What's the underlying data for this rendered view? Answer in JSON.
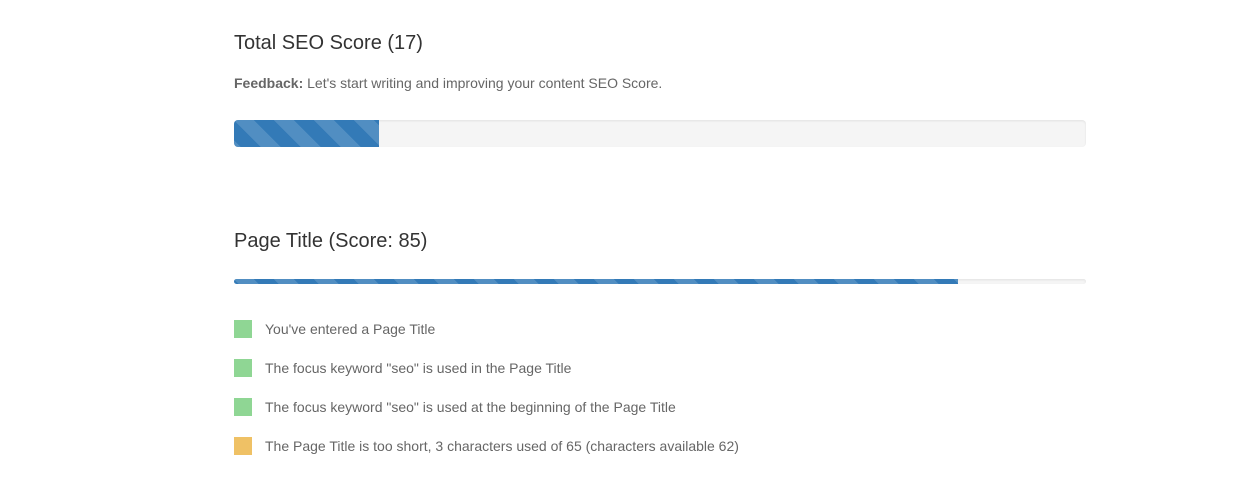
{
  "total": {
    "title": "Total SEO Score (17)",
    "feedback_label": "Feedback:",
    "feedback_text": "Let's start writing and improving your content SEO Score.",
    "score_percent": 17,
    "bar_color": "#337ab7"
  },
  "page_title": {
    "title": "Page Title (Score: 85)",
    "score_percent": 85,
    "bar_color": "#337ab7",
    "checks": [
      {
        "text": "You've entered a Page Title",
        "status": "good",
        "color": "#8fd694"
      },
      {
        "text": "The focus keyword \"seo\" is used in the Page Title",
        "status": "good",
        "color": "#8fd694"
      },
      {
        "text": "The focus keyword \"seo\" is used at the beginning of the Page Title",
        "status": "good",
        "color": "#8fd694"
      },
      {
        "text": "The Page Title is too short, 3 characters used of 65 (characters available 62)",
        "status": "warning",
        "color": "#efc165"
      }
    ]
  }
}
